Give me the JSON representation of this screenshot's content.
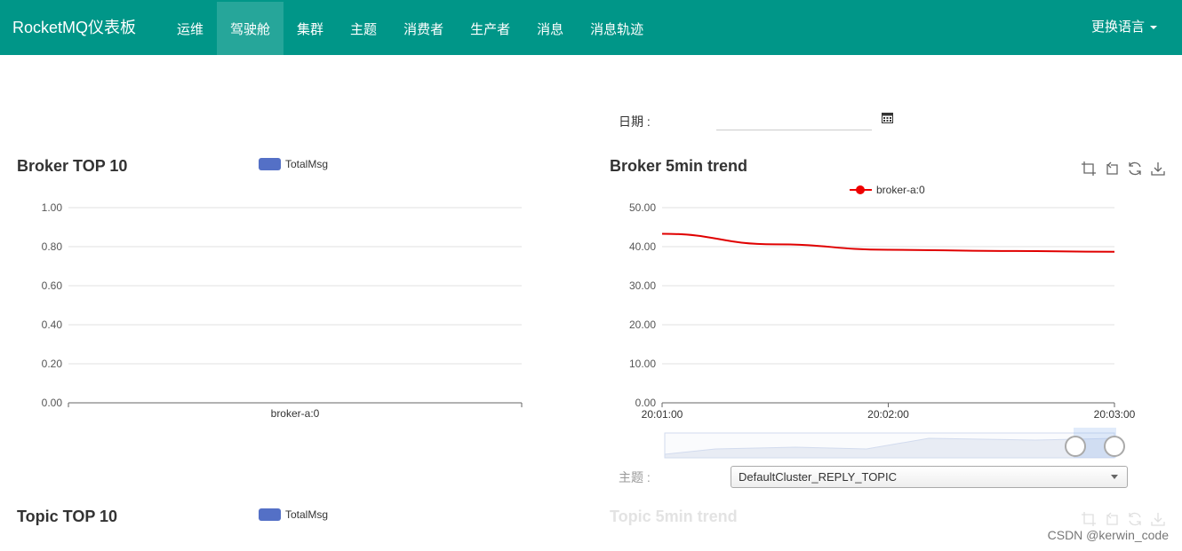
{
  "app": {
    "brand": "RocketMQ仪表板",
    "nav": [
      {
        "label": "运维",
        "active": false
      },
      {
        "label": "驾驶舱",
        "active": true
      },
      {
        "label": "集群",
        "active": false
      },
      {
        "label": "主题",
        "active": false
      },
      {
        "label": "消费者",
        "active": false
      },
      {
        "label": "生产者",
        "active": false
      },
      {
        "label": "消息",
        "active": false
      },
      {
        "label": "消息轨迹",
        "active": false
      }
    ],
    "language_label": "更换语言"
  },
  "filters": {
    "date_label": "日期 :",
    "date_value": "",
    "topic_label": "主题 :",
    "topic_selected": "DefaultCluster_REPLY_TOPIC"
  },
  "panels": {
    "broker_top": {
      "title": "Broker TOP 10",
      "legend": "TotalMsg"
    },
    "broker_trend": {
      "title": "Broker 5min trend",
      "legend": "broker-a:0"
    },
    "topic_top": {
      "title": "Topic TOP 10",
      "legend": "TotalMsg"
    },
    "topic_trend": {
      "title": "Topic 5min trend"
    }
  },
  "colors": {
    "nav_bg": "#009688",
    "nav_active": "#26a69a",
    "bar_series": "#5470c6",
    "line_series": "#e00000"
  },
  "icons": [
    "calendar-icon",
    "crop-zoom-icon",
    "zoom-reset-icon",
    "restore-icon",
    "download-icon"
  ],
  "watermark": "CSDN @kerwin_code",
  "chart_data": [
    {
      "type": "bar",
      "title": "Broker TOP 10",
      "categories": [
        "broker-a:0"
      ],
      "series": [
        {
          "name": "TotalMsg",
          "values": [
            0
          ]
        }
      ],
      "ylim": [
        0,
        1
      ],
      "yticks": [
        "0.00",
        "0.20",
        "0.40",
        "0.60",
        "0.80",
        "1.00"
      ],
      "grid": true,
      "legend": "top-center"
    },
    {
      "type": "line",
      "title": "Broker 5min trend",
      "x": [
        "20:01:00",
        "20:01:30",
        "20:02:00",
        "20:02:30",
        "20:03:00"
      ],
      "xticks": [
        "20:01:00",
        "20:02:00",
        "20:03:00"
      ],
      "series": [
        {
          "name": "broker-a:0",
          "values": [
            43.3,
            40.6,
            39.2,
            38.9,
            38.7
          ]
        }
      ],
      "ylim": [
        0,
        50
      ],
      "yticks": [
        "0.00",
        "10.00",
        "20.00",
        "30.00",
        "40.00",
        "50.00"
      ],
      "grid": true,
      "legend": "top-center"
    }
  ]
}
